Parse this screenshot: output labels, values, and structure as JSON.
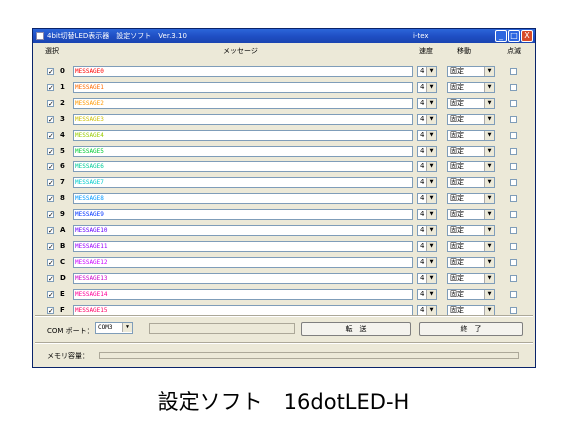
{
  "window": {
    "title": "4bit切替LED表示器　設定ソフト　Ver.3.10",
    "title_right": "i-tex",
    "buttons": [
      "_",
      "□",
      "X"
    ]
  },
  "headers": {
    "select": "選択",
    "message": "メッセージ",
    "speed": "速度",
    "move": "移動",
    "blink": "点滅"
  },
  "rows": [
    {
      "label": "0",
      "message": "MESSAGE0",
      "color": "#ff0000",
      "speed": "4",
      "move": "固定"
    },
    {
      "label": "1",
      "message": "MESSAGE1",
      "color": "#ff6a00",
      "speed": "4",
      "move": "固定"
    },
    {
      "label": "2",
      "message": "MESSAGE2",
      "color": "#ff9900",
      "speed": "4",
      "move": "固定"
    },
    {
      "label": "3",
      "message": "MESSAGE3",
      "color": "#ccc000",
      "speed": "4",
      "move": "固定"
    },
    {
      "label": "4",
      "message": "MESSAGE4",
      "color": "#99cc00",
      "speed": "4",
      "move": "固定"
    },
    {
      "label": "5",
      "message": "MESSAGE5",
      "color": "#00cc33",
      "speed": "4",
      "move": "固定"
    },
    {
      "label": "6",
      "message": "MESSAGE6",
      "color": "#00cc99",
      "speed": "4",
      "move": "固定"
    },
    {
      "label": "7",
      "message": "MESSAGE7",
      "color": "#00cccc",
      "speed": "4",
      "move": "固定"
    },
    {
      "label": "8",
      "message": "MESSAGE8",
      "color": "#0099ff",
      "speed": "4",
      "move": "固定"
    },
    {
      "label": "9",
      "message": "MESSAGE9",
      "color": "#0033ff",
      "speed": "4",
      "move": "固定"
    },
    {
      "label": "A",
      "message": "MESSAGE10",
      "color": "#6600ff",
      "speed": "4",
      "move": "固定"
    },
    {
      "label": "B",
      "message": "MESSAGE11",
      "color": "#9900ff",
      "speed": "4",
      "move": "固定"
    },
    {
      "label": "C",
      "message": "MESSAGE12",
      "color": "#cc00ff",
      "speed": "4",
      "move": "固定"
    },
    {
      "label": "D",
      "message": "MESSAGE13",
      "color": "#cc00cc",
      "speed": "4",
      "move": "固定"
    },
    {
      "label": "E",
      "message": "MESSAGE14",
      "color": "#ff0099",
      "speed": "4",
      "move": "固定"
    },
    {
      "label": "F",
      "message": "MESSAGE15",
      "color": "#ff0066",
      "speed": "4",
      "move": "固定"
    }
  ],
  "bottom": {
    "com_label": "COM ポート：",
    "com_value": "COM3",
    "transfer_button": "転　送",
    "exit_button": "終　了",
    "memory_label": "メモリ容量："
  },
  "caption": "設定ソフト　16dotLED-H"
}
